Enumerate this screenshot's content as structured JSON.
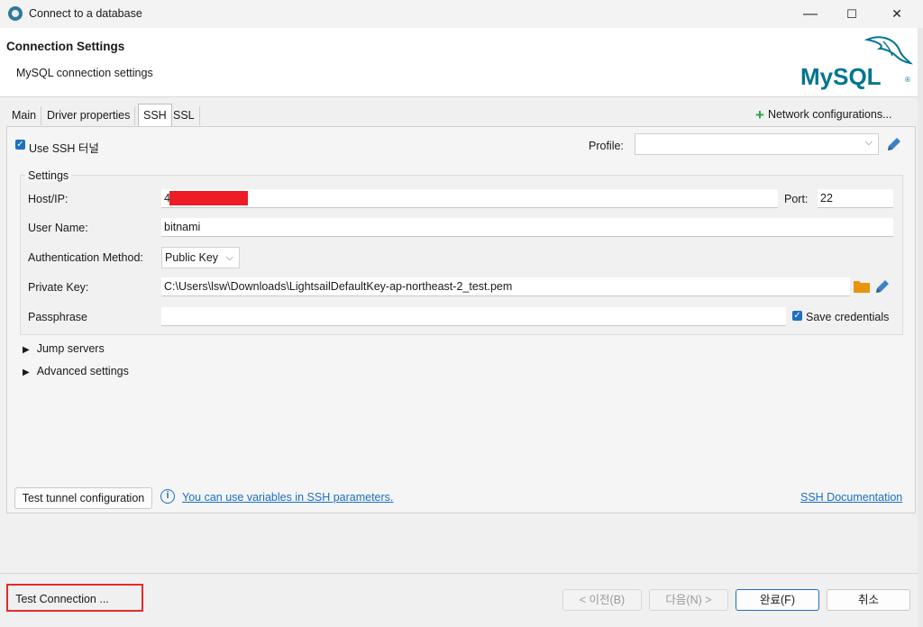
{
  "window": {
    "title": "Connect to a database",
    "controls": {
      "minimize": "—",
      "maximize": "☐",
      "close": "✕"
    }
  },
  "header": {
    "title": "Connection Settings",
    "subtitle": "MySQL connection settings",
    "logo_text": "MySQL",
    "logo_color": "#00758f",
    "logo_accent": "#f29111"
  },
  "tabs": [
    {
      "label": "Main",
      "active": false
    },
    {
      "label": "Driver properties",
      "active": false
    },
    {
      "label": "SSH",
      "active": true
    },
    {
      "label": "SSL",
      "active": false
    }
  ],
  "network_config_label": "Network configurations...",
  "ssh": {
    "use_ssh_label": "Use SSH 터널",
    "use_ssh_checked": true,
    "profile_label": "Profile:",
    "profile_value": "",
    "settings_title": "Settings",
    "host_label": "Host/IP:",
    "host_value_prefix": "4",
    "port_label": "Port:",
    "port_value": "22",
    "user_label": "User Name:",
    "user_value": "bitnami",
    "auth_label": "Authentication Method:",
    "auth_value": "Public Key",
    "key_label": "Private Key:",
    "key_value": "C:\\Users\\lsw\\Downloads\\LightsailDefaultKey-ap-northeast-2_test.pem",
    "passphrase_label": "Passphrase",
    "passphrase_value": "",
    "save_credentials_label": "Save credentials",
    "save_credentials_checked": true,
    "jump_servers_label": "Jump servers",
    "advanced_label": "Advanced settings",
    "test_tunnel_label": "Test tunnel configuration",
    "variables_link": "You can use variables in SSH parameters.",
    "docs_link": "SSH Documentation"
  },
  "footer": {
    "test_connection_label": "Test Connection ...",
    "back_label": "< 이전(B)",
    "next_label": "다음(N) >",
    "finish_label": "완료(F)",
    "cancel_label": "취소"
  },
  "colors": {
    "accent": "#1f6fbf",
    "link": "#1a6fc4",
    "highlight_box": "#e52a2a",
    "plus": "#27a348",
    "folder": "#e8940f"
  }
}
